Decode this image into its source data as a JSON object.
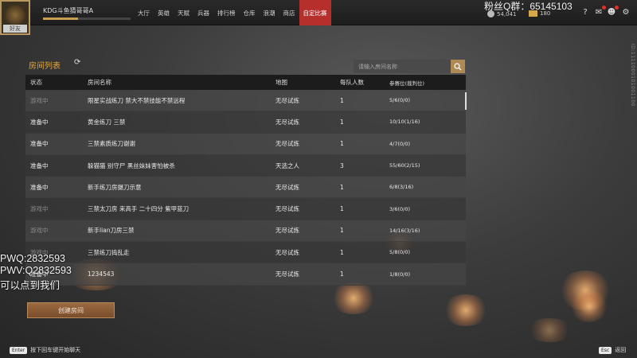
{
  "top_bar": {
    "avatar_label": "好友",
    "player_name": "KDG斗鱼猜哥哥A",
    "nav": [
      "大厅",
      "英雄",
      "天赋",
      "兵器",
      "排行榜",
      "仓库",
      "浪潮",
      "商店",
      "自定比赛"
    ],
    "fan_group": "粉丝Q群：65145103",
    "coins": "54,041",
    "gold": "180",
    "side_id": "ID:1111000101001100"
  },
  "room_list": {
    "title": "房间列表",
    "search_placeholder": "请输入房间名称",
    "columns": [
      "状态",
      "房间名称",
      "地图",
      "每队人数",
      "参赛位(裁判位)"
    ],
    "rows": [
      {
        "status": "游戏中",
        "name": "限星实战练刀 禁大不禁技能不禁远程",
        "map": "无尽试炼",
        "team": "1",
        "slots": "5/6(0/0)"
      },
      {
        "status": "准备中",
        "name": "黄金练刀 三禁",
        "map": "无尽试炼",
        "team": "1",
        "slots": "10/10(1/16)"
      },
      {
        "status": "准备中",
        "name": "三禁素质练刀谢谢",
        "map": "无尽试炼",
        "team": "1",
        "slots": "4/7(0/0)"
      },
      {
        "status": "准备中",
        "name": "躲猫猫 别守尸 黑丝妹妹害怕被杀",
        "map": "天选之人",
        "team": "3",
        "slots": "55/60(2/15)"
      },
      {
        "status": "准备中",
        "name": "新手练刀房摄刀示意",
        "map": "无尽试炼",
        "team": "1",
        "slots": "6/8(3/16)"
      },
      {
        "status": "游戏中",
        "name": "三禁太刀房 来高手 二十四分 紫甲蓝刀",
        "map": "无尽试炼",
        "team": "1",
        "slots": "3/6(0/0)"
      },
      {
        "status": "游戏中",
        "name": "新手lian刀房三禁",
        "map": "无尽试炼",
        "team": "1",
        "slots": "14/16(3/16)"
      },
      {
        "status": "游戏中",
        "name": "三禁练刀捣乱走",
        "map": "无尽试炼",
        "team": "1",
        "slots": "5/8(0/0)"
      },
      {
        "status": "准备中",
        "name": "1234543",
        "map": "无尽试炼",
        "team": "1",
        "slots": "1/8(0/0)"
      }
    ],
    "create_button": "创建房间"
  },
  "overlay": {
    "line1": "PWQ:2832593",
    "line2": "PWV:Q2832593",
    "line3": "可以点到我们"
  },
  "hints": {
    "enter_key": "Enter",
    "enter_text": "按下回车键开始聊天",
    "esc_key": "Esc",
    "esc_text": "返回"
  },
  "colors": {
    "accent_orange": "#e6a93a",
    "nav_active": "#b52f2c",
    "create_button": "#8a5c36"
  }
}
